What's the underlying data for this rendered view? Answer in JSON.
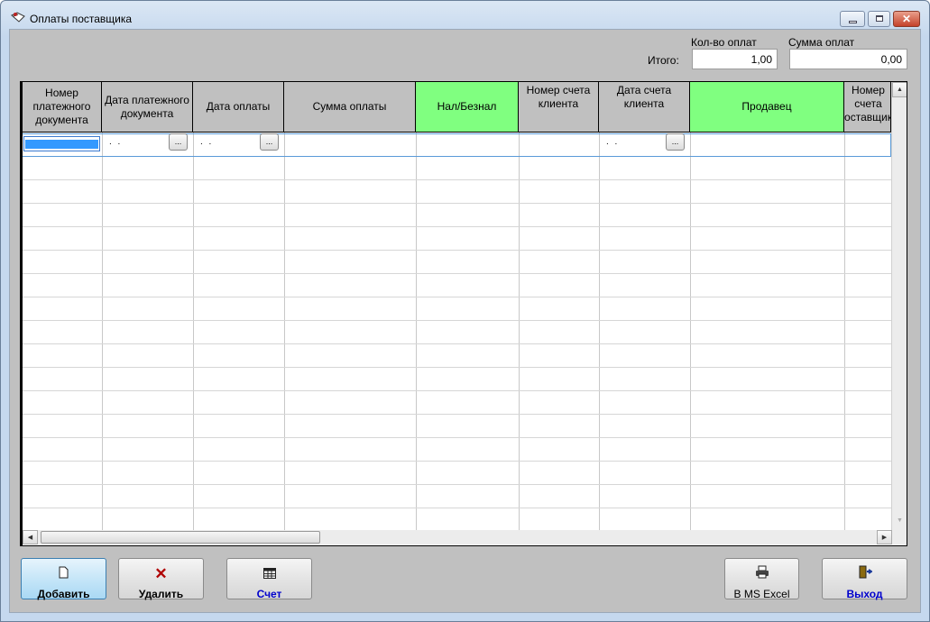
{
  "window": {
    "title": "Оплаты поставщика",
    "icon": "payments-app-icon"
  },
  "totals": {
    "itogo_label": "Итого:",
    "count_label": "Кол-во оплат",
    "count_value": "1,00",
    "sum_label": "Сумма оплат",
    "sum_value": "0,00"
  },
  "grid": {
    "columns": [
      {
        "label": "Номер платежного документа"
      },
      {
        "label": "Дата платежного документа"
      },
      {
        "label": "Дата оплаты"
      },
      {
        "label": "Сумма оплаты"
      },
      {
        "label": "Нал/Безнал",
        "color": "#80ff80"
      },
      {
        "label": "Номер счета клиента"
      },
      {
        "label": "Дата счета клиента"
      },
      {
        "label": "Продавец",
        "color": "#80ff80"
      },
      {
        "label": "Номер счета оставщик"
      }
    ],
    "row1": {
      "date_placeholder": ". .",
      "picker": "..."
    }
  },
  "buttons": {
    "add": "Добавить",
    "delete": "Удалить",
    "invoice": "Счет",
    "excel": "В MS Excel",
    "exit": "Выход"
  },
  "colors": {
    "header_green": "#80ff80",
    "label_blue": "#0000cc",
    "selection": "#3399ff"
  }
}
